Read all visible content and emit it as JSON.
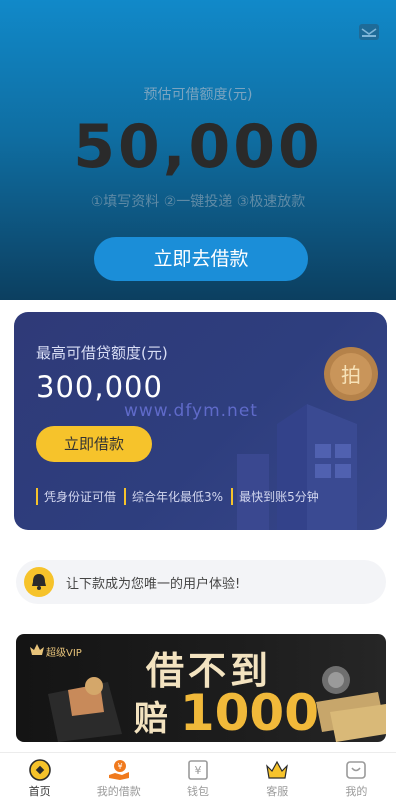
{
  "hero": {
    "estimate_label": "预估可借额度(元)",
    "amount": "50,000",
    "steps": "①填写资料 ②一键投递 ③极速放款",
    "cta_label": "立即去借款"
  },
  "card": {
    "title": "最高可借贷额度(元)",
    "amount": "300,000",
    "watermark": "www.dfym.net",
    "button_label": "立即借款",
    "coin_char": "拍",
    "features": [
      "凭身份证可借",
      "综合年化最低3%",
      "最快到账5分钟"
    ]
  },
  "notice": {
    "text": "让下款成为您唯一的用户体验!"
  },
  "banner": {
    "vip_label": "超级VIP",
    "line1": "借不到",
    "line2_prefix": "赔",
    "line2_amount": "1000"
  },
  "tabbar": {
    "items": [
      {
        "label": "首页",
        "icon": "home-coin-icon",
        "active": true
      },
      {
        "label": "我的借款",
        "icon": "loan-hand-icon",
        "active": false
      },
      {
        "label": "钱包",
        "icon": "wallet-yen-icon",
        "active": false
      },
      {
        "label": "客服",
        "icon": "crown-icon",
        "active": false
      },
      {
        "label": "我的",
        "icon": "profile-icon",
        "active": false
      }
    ]
  },
  "colors": {
    "hero_top": "#1189c9",
    "hero_bottom": "#0c3f60",
    "cta_blue": "#1b8ed8",
    "card_navy": "#2f3a78",
    "accent_yellow": "#f6c32b",
    "tab_active_orange": "#f07a1d"
  }
}
